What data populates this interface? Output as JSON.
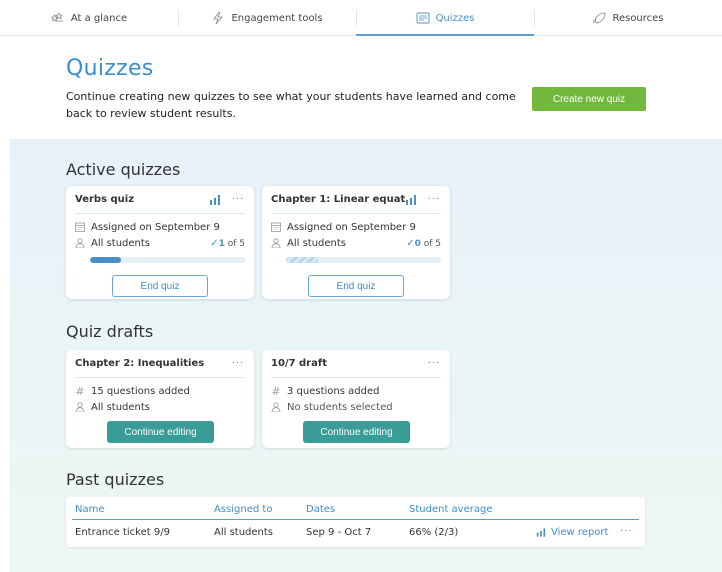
{
  "tabs": [
    {
      "label": "At a glance",
      "icon": "stars-icon"
    },
    {
      "label": "Engagement tools",
      "icon": "lightning-icon"
    },
    {
      "label": "Quizzes",
      "icon": "quiz-icon"
    },
    {
      "label": "Resources",
      "icon": "rocket-icon"
    }
  ],
  "active_tab": "Quizzes",
  "header": {
    "title": "Quizzes",
    "description": "Continue creating new quizzes to see what your students have learned and come back to review student results.",
    "create_button": "Create new quiz"
  },
  "active_quizzes": {
    "title": "Active quizzes",
    "items": [
      {
        "name": "Verbs quiz",
        "assigned": "Assigned on September 9",
        "students": "All students",
        "done": "1",
        "of_total": "of 5",
        "progress": 0.2,
        "button": "End quiz"
      },
      {
        "name": "Chapter 1: Linear equati...",
        "assigned": "Assigned on September 9",
        "students": "All students",
        "done": "0",
        "of_total": "of 5",
        "progress": 0,
        "button": "End quiz"
      }
    ]
  },
  "drafts": {
    "title": "Quiz drafts",
    "items": [
      {
        "name": "Chapter 2: Inequalities",
        "questions": "15 questions added",
        "students": "All students",
        "button": "Continue editing"
      },
      {
        "name": "10/7 draft",
        "questions": "3 questions added",
        "students": "No students selected",
        "button": "Continue editing"
      }
    ]
  },
  "past": {
    "title": "Past quizzes",
    "columns": [
      "Name",
      "Assigned to",
      "Dates",
      "Student average"
    ],
    "rows": [
      {
        "name": "Entrance ticket 9/9",
        "assigned_to": "All students",
        "dates": "Sep 9 - Oct 7",
        "average": "66% (2/3)",
        "view": "View report"
      }
    ]
  },
  "more_glyph": "···",
  "colors": {
    "accent": "#3a8fd0",
    "create": "#72b83c",
    "teal": "#3a9c96"
  }
}
